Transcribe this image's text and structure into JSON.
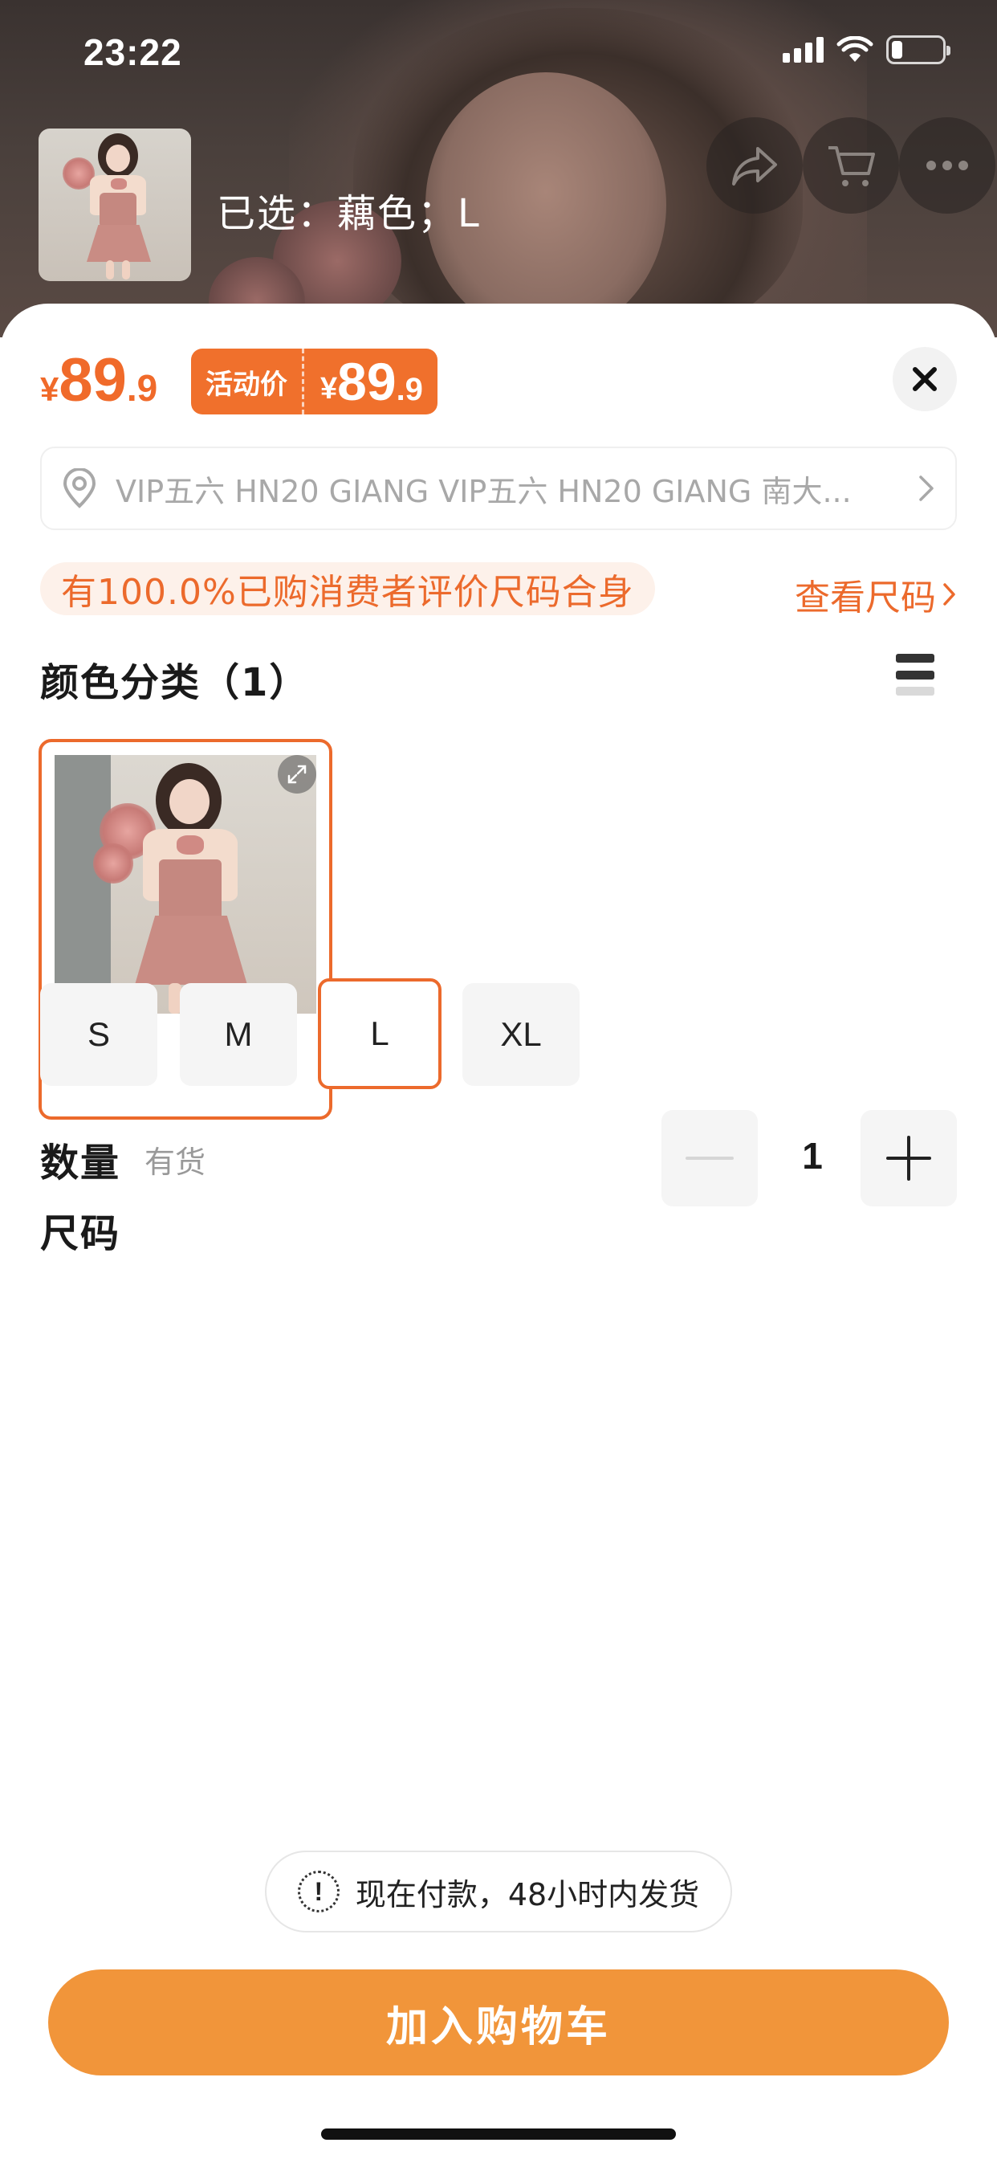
{
  "status_bar": {
    "time": "23:22"
  },
  "header": {
    "selected_label": "已选：藕色；L"
  },
  "price": {
    "currency": "¥",
    "main_int": "89",
    "main_dec": ".9",
    "promo_tag": "活动价",
    "promo_int": "89",
    "promo_dec": ".9"
  },
  "address": {
    "text": "VIP五六 HN20 GIANG VIP五六 HN20 GIANG 南大..."
  },
  "fit": {
    "badge": "有100.0%已购消费者评价尺码合身",
    "size_link": "查看尺码"
  },
  "color_section": {
    "title": "颜色分类（1）",
    "options": [
      {
        "label": "藕色",
        "selected": true
      }
    ]
  },
  "size_section": {
    "title": "尺码",
    "options": [
      "S",
      "M",
      "L",
      "XL"
    ],
    "selected": "L"
  },
  "quantity": {
    "label": "数量",
    "stock": "有货",
    "value": "1"
  },
  "notice": {
    "text": "现在付款，48小时内发货",
    "icon": "!"
  },
  "actions": {
    "add_to_cart": "加入购物车"
  },
  "colors": {
    "accent": "#ec6a2c",
    "cart_button": "#f1953a"
  },
  "icons": [
    "share-icon",
    "cart-icon",
    "more-icon",
    "close-icon",
    "location-icon",
    "chevron-right-icon",
    "list-view-icon",
    "expand-icon",
    "minus-icon",
    "plus-icon",
    "warning-icon"
  ]
}
